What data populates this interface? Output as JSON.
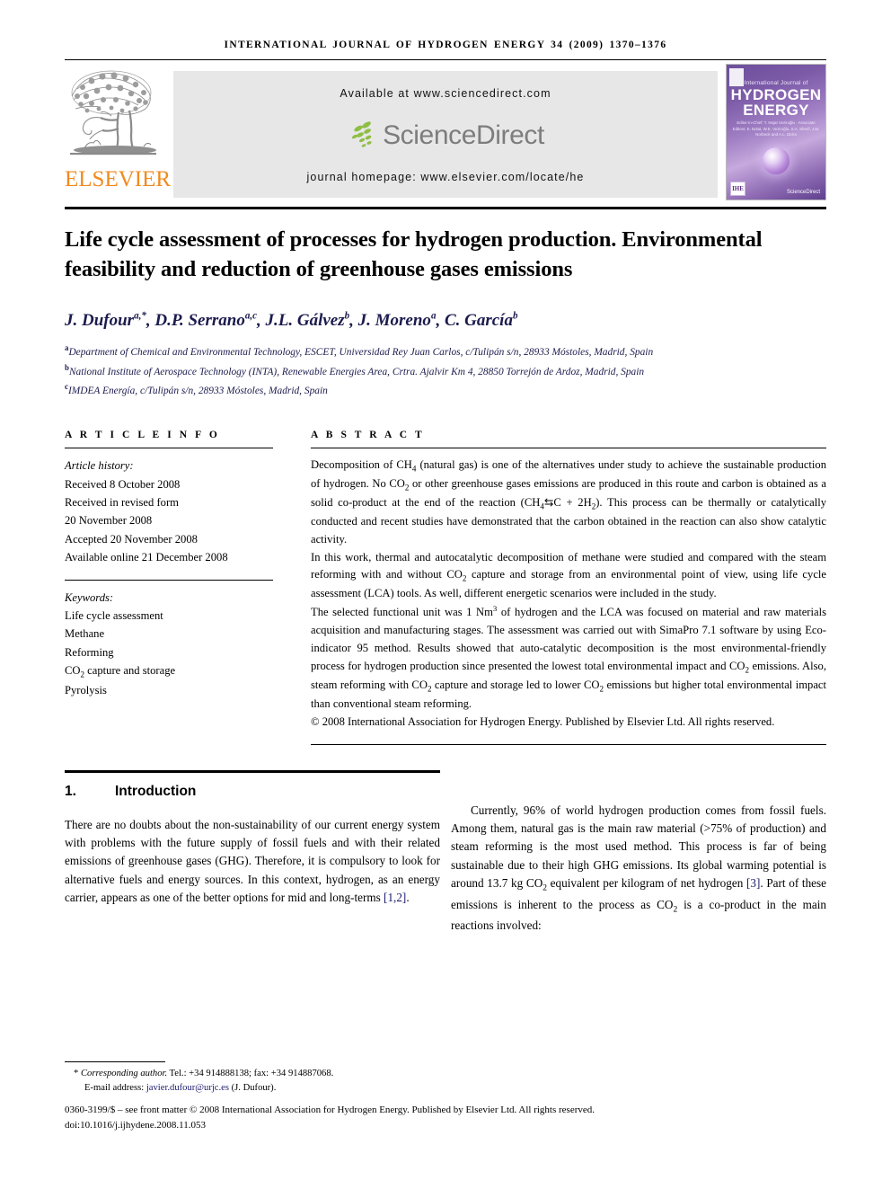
{
  "running_head": "INTERNATIONAL JOURNAL OF HYDROGEN ENERGY 34 (2009) 1370–1376",
  "masthead": {
    "publisher_name": "ELSEVIER",
    "available_at": "Available at www.sciencedirect.com",
    "sciencedirect_logo_text": "ScienceDirect",
    "journal_homepage": "journal homepage: www.elsevier.com/locate/he",
    "cover": {
      "line_top": "International Journal of",
      "line_1": "HYDROGEN",
      "line_2": "ENERGY",
      "editors": "Editor-in-Chief: T. Nejat Veziroğlu  ·  Associate Editors: E. Bolat, W.E. Veziroğlu, S.A. Sherif, J.M. Norbeck and A.L. Dicks",
      "badge": "IHE",
      "sciencedirect_mark": "ScienceDirect"
    }
  },
  "title": "Life cycle assessment of processes for hydrogen production. Environmental feasibility and reduction of greenhouse gases emissions",
  "authors": [
    {
      "name": "J. Dufour",
      "sup": "a,*"
    },
    {
      "name": "D.P. Serrano",
      "sup": "a,c"
    },
    {
      "name": "J.L. Gálvez",
      "sup": "b"
    },
    {
      "name": "J. Moreno",
      "sup": "a"
    },
    {
      "name": "C. García",
      "sup": "b"
    }
  ],
  "affiliations": [
    {
      "marker": "a",
      "text": "Department of Chemical and Environmental Technology, ESCET, Universidad Rey Juan Carlos, c/Tulipán s/n, 28933 Móstoles, Madrid, Spain"
    },
    {
      "marker": "b",
      "text": "National Institute of Aerospace Technology (INTA), Renewable Energies Area, Crtra. Ajalvir Km 4, 28850 Torrejón de Ardoz, Madrid, Spain"
    },
    {
      "marker": "c",
      "text": "IMDEA Energía, c/Tulipán s/n, 28933 Móstoles, Madrid, Spain"
    }
  ],
  "article_info": {
    "heading": "A R T I C L E   I N F O",
    "history_label": "Article history:",
    "history": [
      "Received 8 October 2008",
      "Received in revised form",
      "20 November 2008",
      "Accepted 20 November 2008",
      "Available online 21 December 2008"
    ],
    "keywords_label": "Keywords:",
    "keywords": [
      "Life cycle assessment",
      "Methane",
      "Reforming",
      "CO2 capture and storage",
      "Pyrolysis"
    ]
  },
  "abstract": {
    "heading": "A B S T R A C T",
    "paragraph_1": "Decomposition of CH4 (natural gas) is one of the alternatives under study to achieve the sustainable production of hydrogen. No CO2 or other greenhouse gases emissions are produced in this route and carbon is obtained as a solid co-product at the end of the reaction (CH4 ⇆ C + 2H2). This process can be thermally or catalytically conducted and recent studies have demonstrated that the carbon obtained in the reaction can also show catalytic activity.",
    "paragraph_2": "In this work, thermal and autocatalytic decomposition of methane were studied and compared with the steam reforming with and without CO2 capture and storage from an environmental point of view, using life cycle assessment (LCA) tools. As well, different energetic scenarios were included in the study.",
    "paragraph_3": "The selected functional unit was 1 Nm3 of hydrogen and the LCA was focused on material and raw materials acquisition and manufacturing stages. The assessment was carried out with SimaPro 7.1 software by using Eco-indicator 95 method. Results showed that autocatalytic decomposition is the most environmental-friendly process for hydrogen production since presented the lowest total environmental impact and CO2 emissions. Also, steam reforming with CO2 capture and storage led to lower CO2 emissions but higher total environmental impact than conventional steam reforming.",
    "copyright": "© 2008 International Association for Hydrogen Energy. Published by Elsevier Ltd. All rights reserved."
  },
  "section": {
    "number": "1.",
    "title": "Introduction",
    "left_paragraph": "There are no doubts about the non-sustainability of our current energy system with problems with the future supply of fossil fuels and with their related emissions of greenhouse gases (GHG). Therefore, it is compulsory to look for alternative fuels and energy sources. In this context, hydrogen, as an energy carrier, appears as one of the better options for mid and long-terms [1,2].",
    "right_paragraph": "Currently, 96% of world hydrogen production comes from fossil fuels. Among them, natural gas is the main raw material (>75% of production) and steam reforming is the most used method. This process is far of being sustainable due to their high GHG emissions. Its global warming potential is around 13.7 kg CO2 equivalent per kilogram of net hydrogen [3]. Part of these emissions is inherent to the process as CO2 is a co-product in the main reactions involved:"
  },
  "footnotes": {
    "corresponding_label": "Corresponding author.",
    "contact": " Tel.: +34 914888138; fax: +34 914887068.",
    "email_label": "E-mail address:",
    "email": "javier.dufour@urjc.es",
    "email_owner": "(J. Dufour).",
    "issn_line": "0360-3199/$ – see front matter © 2008 International Association for Hydrogen Energy. Published by Elsevier Ltd. All rights reserved.",
    "doi": "doi:10.1016/j.ijhydene.2008.11.053"
  },
  "colors": {
    "elsevier_orange": "#F08A1E",
    "author_blue": "#1B1B4E",
    "link_blue": "#1B1B6E",
    "band_gray": "#E7E7E7",
    "sd_gray": "#7D7D7D",
    "sd_leaf_green": "#8FBE44"
  }
}
